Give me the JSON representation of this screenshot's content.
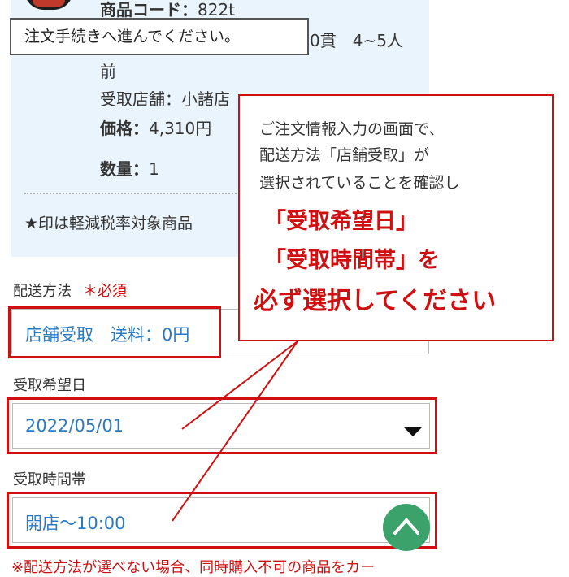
{
  "product": {
    "code_label": "商品コード：",
    "code_value": "822t",
    "size_text": "0貫　4~5人",
    "size_cont": "前",
    "store_text": "受取店舗：小諸店",
    "price_label": "価格：",
    "price_value": "4,310円",
    "quantity_label": "数量：",
    "quantity_value": "1",
    "tax_note": "★印は軽減税率対象商品"
  },
  "tooltip": {
    "text": "注文手続きへ進んでください。"
  },
  "callout": {
    "line1": "ご注文情報入力の画面で、",
    "line2": "配送方法「店舗受取」が",
    "line3": "選択されていることを確認し",
    "line4": "「受取希望日」",
    "line5": "「受取時間帯」を",
    "line6_emph": "必ず選択",
    "line6_rest": "してください"
  },
  "form": {
    "delivery": {
      "label": "配送方法",
      "required": "＊必須",
      "value": "店舗受取　送料：0円"
    },
    "date": {
      "label": "受取希望日",
      "value": "2022/05/01"
    },
    "time": {
      "label": "受取時間帯",
      "value": "開店〜10:00"
    },
    "note": "※配送方法が選べない場合、同時購入不可の商品をカー"
  },
  "icons": {
    "dropdown": "caret-down-icon",
    "scroll_top": "chevron-up-icon"
  },
  "colors": {
    "accent_red": "#d01010",
    "value_blue": "#2a7ac4",
    "panel_bg": "#eaf4fc",
    "fab_green": "#3aa26a"
  }
}
